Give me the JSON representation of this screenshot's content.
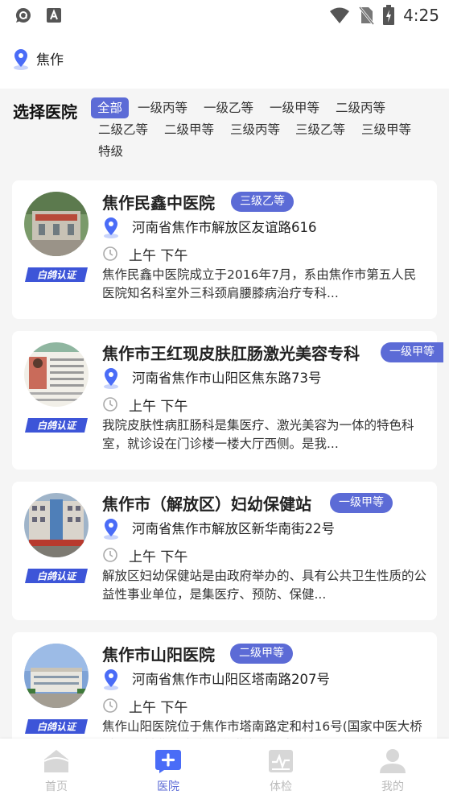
{
  "status_bar": {
    "time": "4:25"
  },
  "location": {
    "city": "焦作"
  },
  "filter": {
    "title": "选择医院",
    "options": [
      "全部",
      "一级丙等",
      "一级乙等",
      "一级甲等",
      "二级丙等",
      "二级乙等",
      "二级甲等",
      "三级丙等",
      "三级乙等",
      "三级甲等",
      "特级"
    ],
    "selected": "全部"
  },
  "hospitals": [
    {
      "name": "焦作民鑫中医院",
      "level": "三级乙等",
      "address": "河南省焦作市解放区友谊路616",
      "hours": "上午 下午",
      "description": "焦作民鑫中医院成立于2016年7月，系由焦作市第五人民医院知名科室外三科颈肩腰膝病治疗专科..."
    },
    {
      "name": "焦作市王红现皮肤肛肠激光美容专科",
      "level": "一级甲等",
      "address": "河南省焦作市山阳区焦东路73号",
      "hours": "上午 下午",
      "description": "我院皮肤性病肛肠科是集医疗、激光美容为一体的特色科室，就诊设在门诊楼一楼大厅西侧。是我..."
    },
    {
      "name": "焦作市（解放区）妇幼保健站",
      "level": "一级甲等",
      "address": "河南省焦作市解放区新华南街22号",
      "hours": "上午 下午",
      "description": "解放区妇幼保健站是由政府举办的、具有公共卫生性质的公益性事业单位，是集医疗、预防、保健..."
    },
    {
      "name": "焦作市山阳医院",
      "level": "二级甲等",
      "address": "河南省焦作市山阳区塔南路207号",
      "hours": "上午 下午",
      "description": "焦作山阳医院位于焦作市塔南路定和村16号(国家中医大桥对面)下辖焦作市文昌道塔南路，南临高"
    }
  ],
  "certification_label": "白鸽认证",
  "bottom_nav": [
    {
      "label": "首页",
      "icon": "home-icon",
      "active": false
    },
    {
      "label": "医院",
      "icon": "hospital-icon",
      "active": true
    },
    {
      "label": "体检",
      "icon": "checkup-icon",
      "active": false
    },
    {
      "label": "我的",
      "icon": "profile-icon",
      "active": false
    }
  ],
  "colors": {
    "accent": "#5c6bd6",
    "icon_blue": "#4a6cf7",
    "icon_gray": "#aaaaaa"
  }
}
